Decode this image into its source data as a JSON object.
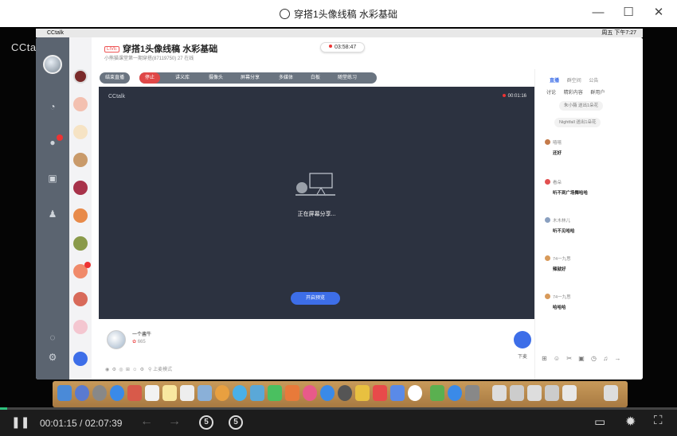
{
  "window": {
    "title": "穿搭1头像线稿 水彩基础",
    "minimize": "—",
    "maximize": "☐",
    "close": "✕"
  },
  "video": {
    "watermark": "CCtalk",
    "macbar": {
      "app": "CCtalk",
      "clock": "周五 下午7:27"
    },
    "app": {
      "room_tag": "LIVE",
      "room_title": "穿搭1头像线稿 水彩基础",
      "room_sub": "小熊猫课堂第一期穿搭(87119750)   27 在线",
      "timer": "03:58:47",
      "toolbar": [
        "结束直播",
        "停止",
        "讲义库",
        "摄像头",
        "屏幕分享",
        "多媒体",
        "白板",
        "随堂练习"
      ],
      "stage": {
        "brand": "CCtalk",
        "record_time": "00:01:16",
        "sharing_text": "正在屏幕分享...",
        "preview_button": "开启预览"
      },
      "teacher": {
        "name": "一个酱牛",
        "followers": "665",
        "mode": "上麦模式",
        "down_label": "下麦"
      },
      "right_panel": {
        "tabs": [
          "直播",
          "群空间",
          "公告"
        ],
        "subtabs": [
          "讨论",
          "精彩内容",
          "群用户"
        ],
        "gifts": [
          "朱小薇 送出1朵花",
          "Nightfall 送出1朵花"
        ],
        "messages": [
          {
            "user": "嘻嘻",
            "text": "还好"
          },
          {
            "user": "看朵",
            "text": "听不到广场舞哈哈"
          },
          {
            "user": "木木林儿",
            "text": "听不见哈哈"
          },
          {
            "user": "74一九思",
            "text": "辣就好"
          },
          {
            "user": "74一九思",
            "text": "哈哈哈"
          }
        ],
        "tools": "⊞ ☺ ✂ ▣ ◷ ♫ →"
      }
    }
  },
  "player": {
    "progress": 0.01,
    "current_time": "00:01:15",
    "separator": " / ",
    "duration": "02:07:39",
    "skip_back": "5",
    "skip_forward": "5"
  },
  "colors": {
    "accent": "#3d6ee8",
    "progress": "#2ec27e",
    "stage": "#2c3240",
    "sidebar": "#5b6470",
    "dock": "#b8884e"
  }
}
